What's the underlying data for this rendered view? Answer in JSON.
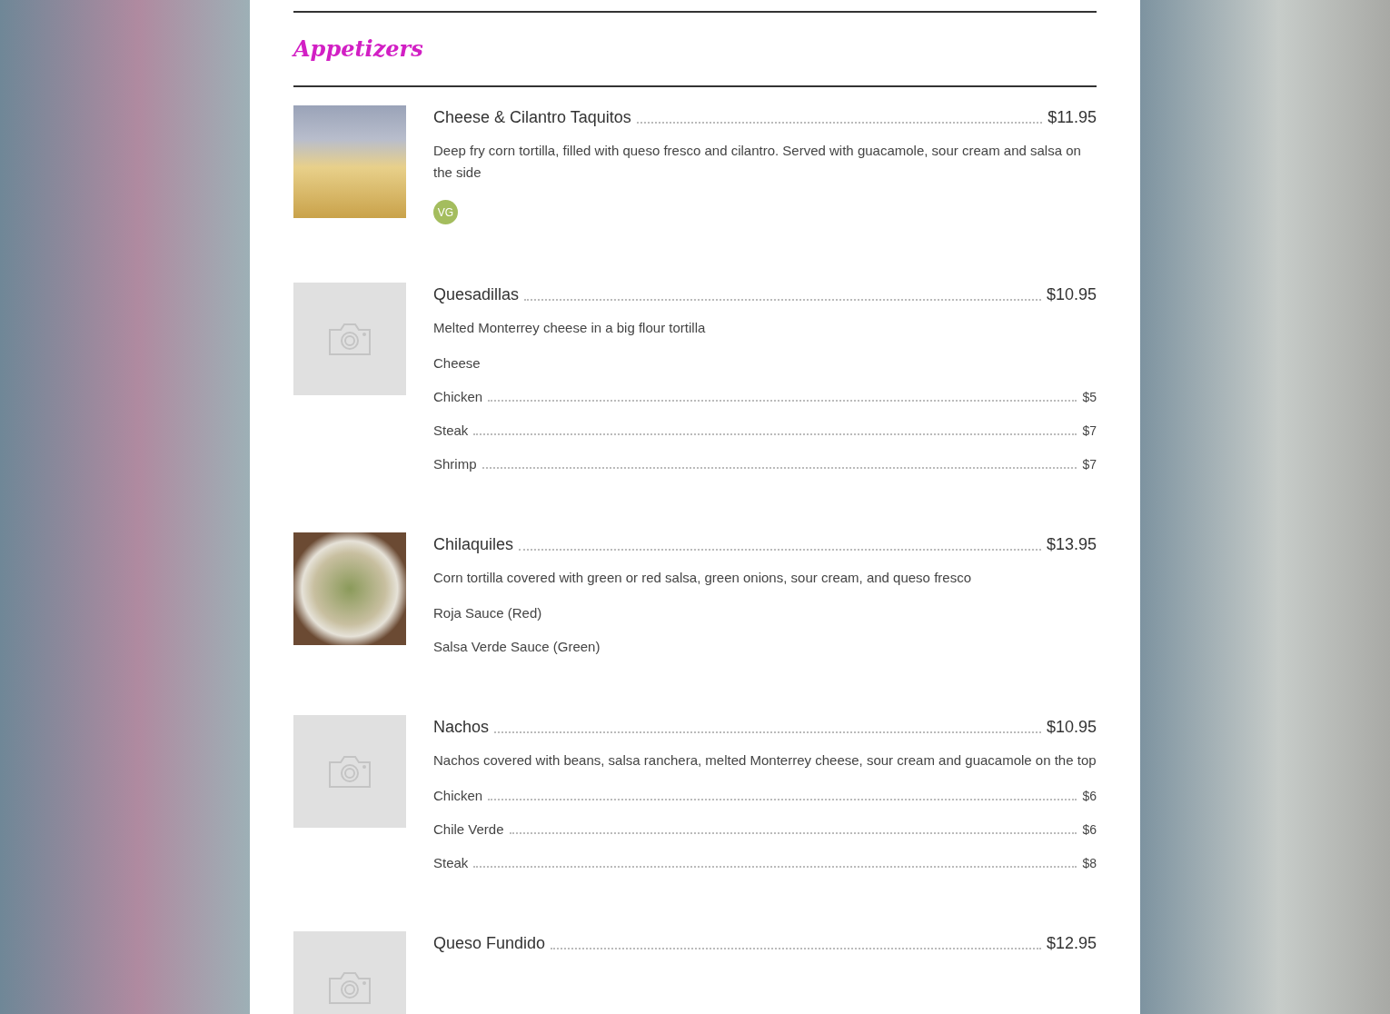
{
  "section": {
    "title": "Appetizers"
  },
  "items": [
    {
      "name": "Cheese & Cilantro Taquitos",
      "price": "$11.95",
      "kind": "photo",
      "description": "Deep fry corn tortilla, filled with queso fresco and cilantro. Served with guacamole, sour cream and salsa on the side",
      "badges": [
        "VG"
      ]
    },
    {
      "name": "Quesadillas",
      "price": "$10.95",
      "kind": "placeholder",
      "description": "Melted Monterrey cheese in a big flour tortilla",
      "options": [
        {
          "label": "Cheese"
        },
        {
          "label": "Chicken",
          "price": "$5"
        },
        {
          "label": "Steak",
          "price": "$7"
        },
        {
          "label": "Shrimp",
          "price": "$7"
        }
      ]
    },
    {
      "name": "Chilaquiles",
      "price": "$13.95",
      "kind": "photo",
      "description": "Corn tortilla covered with green or red salsa, green onions, sour cream, and queso fresco",
      "options": [
        {
          "label": "Roja Sauce (Red)"
        },
        {
          "label": "Salsa Verde Sauce (Green)"
        }
      ]
    },
    {
      "name": "Nachos",
      "price": "$10.95",
      "kind": "placeholder",
      "description": "Nachos covered with beans, salsa ranchera, melted Monterrey cheese, sour cream and guacamole on the top",
      "options": [
        {
          "label": "Chicken",
          "price": "$6"
        },
        {
          "label": "Chile Verde",
          "price": "$6"
        },
        {
          "label": "Steak",
          "price": "$8"
        }
      ]
    },
    {
      "name": "Queso Fundido",
      "price": "$12.95",
      "kind": "placeholder"
    }
  ]
}
